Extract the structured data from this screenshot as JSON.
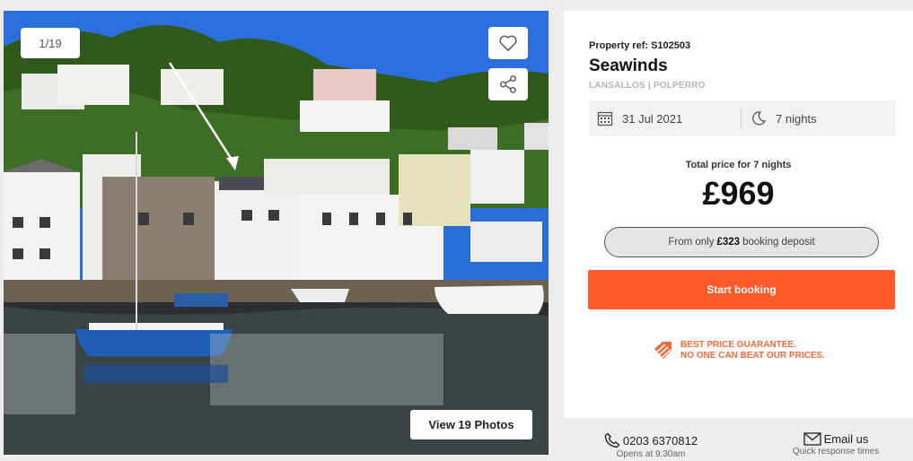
{
  "gallery": {
    "counter": "1/19",
    "favourite_icon": "heart-icon",
    "share_icon": "share-icon",
    "view_photos_label": "View 19 Photos"
  },
  "property": {
    "ref": "Property ref: S102503",
    "name": "Seawinds",
    "location": "LANSALLOS | POLPERRO"
  },
  "stay": {
    "date": "31 Jul 2021",
    "date_icon": "calendar-icon",
    "nights": "7 nights",
    "nights_icon": "moon-icon"
  },
  "pricing": {
    "total_label": "Total price for 7 nights",
    "price": "£969",
    "deposit_prefix": "From only",
    "deposit_amount": "£323",
    "deposit_suffix": "booking deposit"
  },
  "actions": {
    "start_booking": "Start booking"
  },
  "guarantee": {
    "line1": "BEST PRICE GUARANTEE.",
    "line2": "NO ONE CAN BEAT OUR PRICES.",
    "icon": "price-tag-icon"
  },
  "contact": {
    "phone": "0203 6370812",
    "phone_sub": "Opens at 9:30am",
    "email": "Email us",
    "email_sub": "Quick response times"
  },
  "colors": {
    "accent": "#fc5a2a",
    "guarantee": "#f36a3c",
    "location_grey": "#b4b4b4"
  }
}
